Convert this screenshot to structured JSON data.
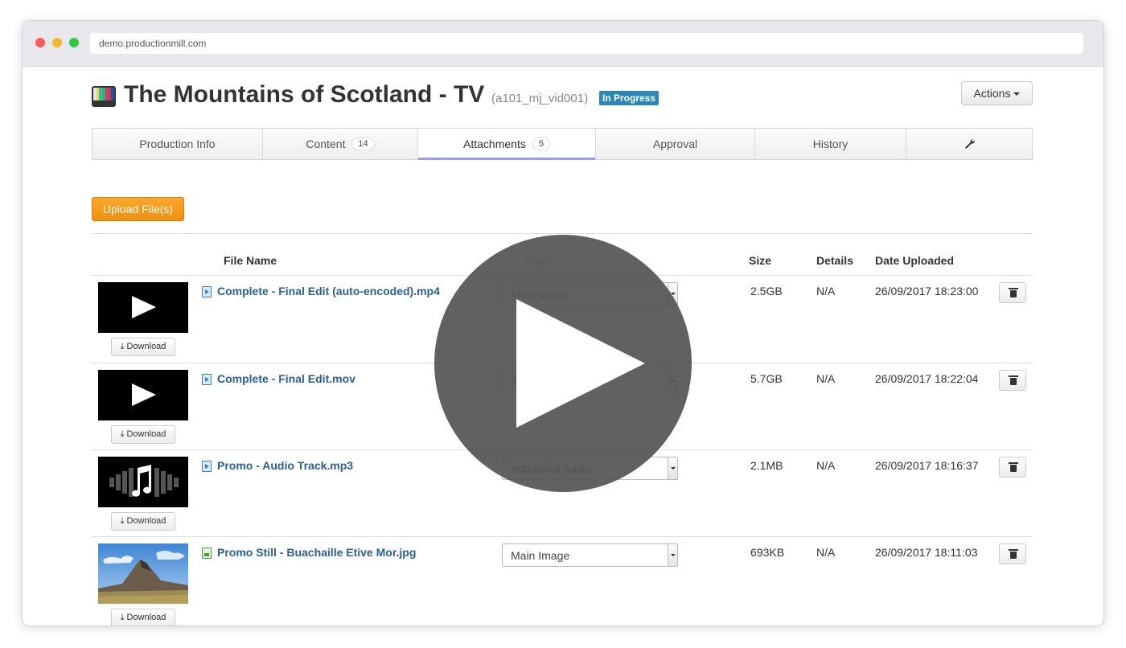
{
  "browser": {
    "url": "demo.productionmill.com"
  },
  "header": {
    "title": "The Mountains of Scotland - TV",
    "job_code": "(a101_mj_vid001)",
    "status": "In Progress",
    "actions_label": "Actions"
  },
  "tabs": [
    {
      "label": "Production Info",
      "count": null
    },
    {
      "label": "Content",
      "count": "14"
    },
    {
      "label": "Attachments",
      "count": "5"
    },
    {
      "label": "Approval",
      "count": null
    },
    {
      "label": "History",
      "count": null
    }
  ],
  "upload_label": "Upload File(s)",
  "table": {
    "headers": {
      "file_name": "File Name",
      "type": "Type",
      "size": "Size",
      "details": "Details",
      "date": "Date Uploaded"
    },
    "download_label": "Download",
    "rows": [
      {
        "file_name": "Complete - Final Edit (auto-encoded).mp4",
        "type": "Main Video",
        "size": "2.5GB",
        "details": "N/A",
        "date": "26/09/2017 18:23:00",
        "thumb": "video"
      },
      {
        "file_name": "Complete - Final Edit.mov",
        "type": "A",
        "size": "5.7GB",
        "details": "N/A",
        "date": "26/09/2017 18:22:04",
        "thumb": "video"
      },
      {
        "file_name": "Promo - Audio Track.mp3",
        "type": "Additional Audio",
        "size": "2.1MB",
        "details": "N/A",
        "date": "26/09/2017 18:16:37",
        "thumb": "audio"
      },
      {
        "file_name": "Promo Still - Buachaille Etive Mor.jpg",
        "type": "Main Image",
        "size": "693KB",
        "details": "N/A",
        "date": "26/09/2017 18:11:03",
        "thumb": "image"
      }
    ]
  },
  "icons": {
    "wrench_tab": "wrench-icon",
    "delete": "trash-icon",
    "download": "download-icon",
    "overlay": "play-icon"
  }
}
